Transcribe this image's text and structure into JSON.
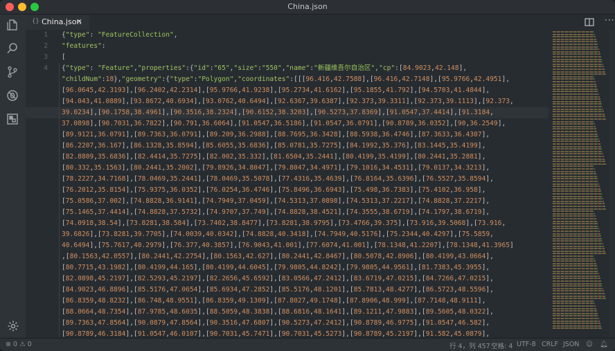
{
  "window": {
    "title": "China.json"
  },
  "tab": {
    "icon": "{}",
    "label": "China.json",
    "close": "×"
  },
  "editor": {
    "lines": [
      {
        "number": "1",
        "text": "{\"type\": \"FeatureCollection\","
      },
      {
        "number": "2",
        "text": "\"features\":"
      },
      {
        "number": "3",
        "text": "["
      },
      {
        "number": "4",
        "text": "{\"type\": \"Feature\",\"properties\":{\"id\":\"65\",\"size\":\"550\",\"name\":\"新疆维吾尔自治区\",\"cp\":[84.9023,42.148],"
      },
      {
        "number": "",
        "text": "\"childNum\":18},\"geometry\":{\"type\":\"Polygon\",\"coordinates\":[[[96.416,42.7588],[96.416,42.7148],[95.9766,42.4951],"
      },
      {
        "number": "",
        "text": "[96.0645,42.3193],[96.2402,42.2314],[95.9766,41.9238],[95.2734,41.6162],[95.1855,41.792],[94.5703,41.4844],"
      },
      {
        "number": "",
        "text": "[94.043,41.0889],[93.8672,40.6934],[93.0762,40.6494],[92.6367,39.6387],[92.373,39.3311],[92.373,39.1113],[92.373,"
      },
      {
        "number": "",
        "text": "39.0234],[90.1758,38.4961],[90.3516,38.2324],[90.6152,38.3203],[90.5273,37.8369],[91.0547,37.4414],[91.3184,"
      },
      {
        "number": "",
        "text": "37.0898],[90.7031,36.7822],[90.791,36.6064],[91.0547,36.5186],[91.0547,36.0791],[90.8789,36.0352],[90,36.2549],"
      },
      {
        "number": "",
        "text": "[89.9121,36.0791],[89.7363,36.0791],[89.209,36.2988],[88.7695,36.3428],[88.5938,36.4746],[87.3633,36.4307],"
      },
      {
        "number": "",
        "text": "[86.2207,36.167],[86.1328,35.8594],[85.6055,35.6836],[85.0781,35.7275],[84.1992,35.376],[83.1445,35.4199],"
      },
      {
        "number": "",
        "text": "[82.8809,35.6836],[82.4414,35.7275],[82.002,35.332],[81.6504,35.2441],[80.4199,35.4199],[80.2441,35.2881],"
      },
      {
        "number": "",
        "text": "[80.332,35.1563],[80.2441,35.2002],[79.8926,34.8047],[79.8047,34.4971],[79.1016,34.4531],[79.0137,34.3213],"
      },
      {
        "number": "",
        "text": "[78.2227,34.7168],[78.0469,35.2441],[78.0469,35.5078],[77.4316,35.4639],[76.8164,35.6396],[76.5527,35.8594],"
      },
      {
        "number": "",
        "text": "[76.2012,35.8154],[75.9375,36.0352],[76.0254,36.4746],[75.8496,36.6943],[75.498,36.7383],[75.4102,36.958],"
      },
      {
        "number": "",
        "text": "[75.0586,37.002],[74.8828,36.9141],[74.7949,37.0459],[74.5313,37.0898],[74.5313,37.2217],[74.8828,37.2217],"
      },
      {
        "number": "",
        "text": "[75.1465,37.4414],[74.8828,37.5732],[74.9707,37.749],[74.8828,38.4521],[74.3555,38.6719],[74.1797,38.6719],"
      },
      {
        "number": "",
        "text": "[74.0918,38.54],[73.8281,38.584],[73.7402,38.8477],[73.8281,38.9795],[73.4766,39.375],[73.916,39.5068],[73.916,"
      },
      {
        "number": "",
        "text": "39.6826],[73.8281,39.7705],[74.0039,40.0342],[74.8828,40.3418],[74.7949,40.5176],[75.2344,40.4297],[75.5859,"
      },
      {
        "number": "",
        "text": "40.6494],[75.7617,40.2979],[76.377,40.3857],[76.9043,41.001],[77.6074,41.001],[78.1348,41.2207],[78.1348,41.3965]"
      },
      {
        "number": "",
        "text": ",[80.1563,42.0557],[80.2441,42.2754],[80.1563,42.627],[80.2441,42.8467],[80.5078,42.8906],[80.4199,43.0664],"
      },
      {
        "number": "",
        "text": "[80.7715,43.1982],[80.4199,44.165],[80.4199,44.6045],[79.9805,44.8242],[79.9805,44.9561],[81.7383,45.3955],"
      },
      {
        "number": "",
        "text": "[82.0898,45.2197],[82.5293,45.2197],[82.2656,45.6592],[83.0566,47.2412],[83.6719,47.0215],[84.7266,47.0215],"
      },
      {
        "number": "",
        "text": "[84.9023,46.8896],[85.5176,47.0654],[85.6934,47.2852],[85.5176,48.1201],[85.7813,48.4277],[86.5723,48.5596],"
      },
      {
        "number": "",
        "text": "[86.8359,48.8232],[86.748,48.9551],[86.8359,49.1309],[87.8027,49.1748],[87.8906,48.999],[87.7148,48.9111],"
      },
      {
        "number": "",
        "text": "[88.0664,48.7354],[87.9785,48.6035],[88.5059,48.3838],[88.6816,48.1641],[89.1211,47.9883],[89.5605,48.0322],"
      },
      {
        "number": "",
        "text": "[89.7363,47.8564],[90.0879,47.8564],[90.3516,47.6807],[90.5273,47.2412],[90.8789,46.9775],[91.0547,46.582],"
      },
      {
        "number": "",
        "text": "[90.8789,46.3184],[91.0547,46.0107],[90.7031,45.7471],[90.7031,45.5273],[90.8789,45.2197],[91.582,45.0879],"
      }
    ],
    "cursor_line_index": 7
  },
  "statusbar": {
    "errors": "0",
    "warnings": "0",
    "position": "行 4，列 457",
    "spaces": "空格: 4",
    "encoding": "UTF-8",
    "eol": "CRLF",
    "language": "JSON"
  },
  "activity_icons": [
    "files-icon",
    "search-icon",
    "source-control-icon",
    "debug-icon",
    "extensions-icon",
    "settings-gear-icon"
  ]
}
